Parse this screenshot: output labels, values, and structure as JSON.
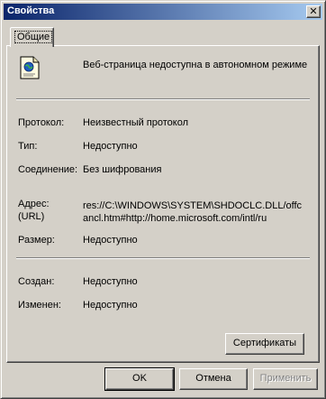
{
  "window": {
    "title": "Свойства",
    "close_glyph": "✕"
  },
  "tabs": [
    {
      "label": "Общие"
    }
  ],
  "header": {
    "icon": "web-page-icon",
    "description": "Веб-страница недоступна в автономном режиме"
  },
  "properties": {
    "protocol": {
      "label": "Протокол:",
      "value": "Неизвестный протокол"
    },
    "type": {
      "label": "Тип:",
      "value": "Недоступно"
    },
    "connection": {
      "label": "Соединение:",
      "value": "Без шифрования"
    },
    "address": {
      "label_line1": "Адрес:",
      "label_line2": "(URL)",
      "value_line1": "res://C:\\WINDOWS\\SYSTEM\\SHDOCLC.DLL/offc",
      "value_line2": "ancl.htm#http://home.microsoft.com/intl/ru"
    },
    "size": {
      "label": "Размер:",
      "value": "Недоступно"
    },
    "created": {
      "label": "Создан:",
      "value": "Недоступно"
    },
    "modified": {
      "label": "Изменен:",
      "value": "Недоступно"
    }
  },
  "buttons": {
    "certificates": "Сертификаты",
    "ok": "OK",
    "cancel": "Отмена",
    "apply": "Применить"
  },
  "colors": {
    "titlebar_start": "#0a246a",
    "titlebar_end": "#a6caf0",
    "face": "#d4d0c8"
  }
}
